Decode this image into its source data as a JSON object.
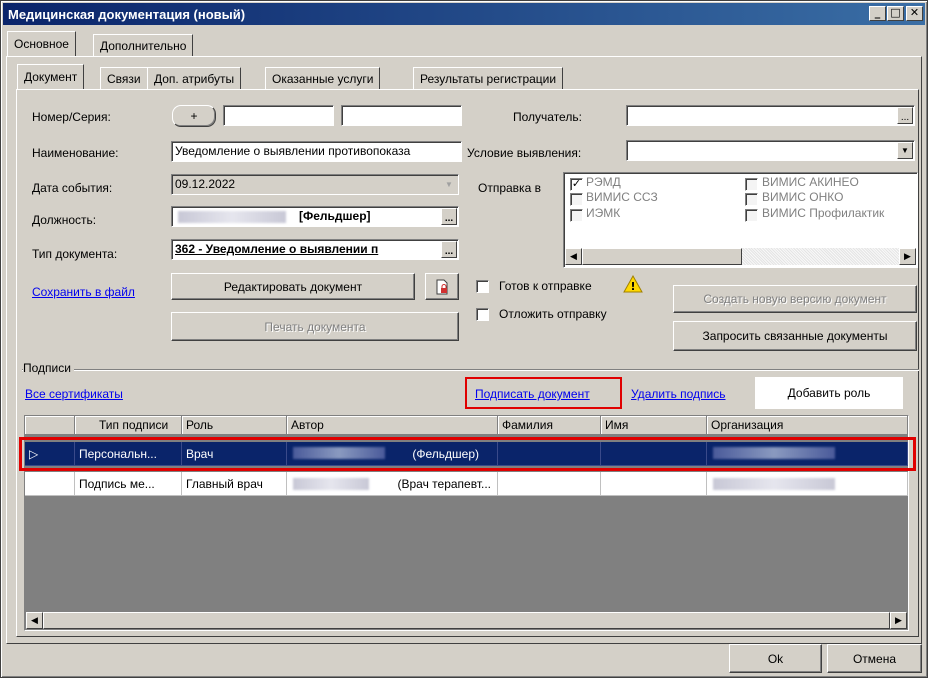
{
  "window": {
    "title": "Медицинская документация (новый)",
    "minimize": "_",
    "maximize": "□",
    "close": "✕"
  },
  "outer_tabs": [
    "Основное",
    "Дополнительно"
  ],
  "inner_tabs": [
    "Документ",
    "Связи",
    "Доп. атрибуты",
    "Оказанные услуги",
    "Результаты регистрации"
  ],
  "form": {
    "number_label": "Номер/Серия:",
    "plus": "+",
    "name_label": "Наименование:",
    "name_value": "Уведомление о выявлении противопоказа",
    "date_label": "Дата события:",
    "date_value": "09.12.2022",
    "position_label": "Должность:",
    "position_value": "[Фельдшер]",
    "doctype_label": "Тип документа:",
    "doctype_value": "362 - Уведомление о выявлении п",
    "save_file": "Сохранить в файл",
    "edit_doc": "Редактировать документ",
    "print_doc": "Печать документа",
    "recipient_label": "Получатель:",
    "condition_label": "Условие выявления:",
    "send_label": "Отправка в",
    "send_options": [
      {
        "label": "РЭМД",
        "checked": "✓"
      },
      {
        "label": "ВИМИС АКИНЕО",
        "checked": ""
      },
      {
        "label": "ВИМИС ССЗ",
        "checked": ""
      },
      {
        "label": "ВИМИС ОНКО",
        "checked": ""
      },
      {
        "label": "ИЭМК",
        "checked": ""
      },
      {
        "label": "ВИМИС Профилактик",
        "checked": ""
      }
    ],
    "ready_label": "Готов к отправке",
    "warning_icon": "!",
    "postpone_label": "Отложить отправку",
    "new_version": "Создать новую версию документ",
    "request_related": "Запросить связанные документы"
  },
  "signatures": {
    "group_label": "Подписи",
    "all_certs": "Все сертификаты",
    "sign_doc": "Подписать документ",
    "delete_sign": "Удалить подпись",
    "add_role": "Добавить роль",
    "columns": [
      "Тип подписи",
      "Роль",
      "Автор",
      "Фамилия",
      "Имя",
      "Организация"
    ],
    "rows": [
      {
        "indicator": "▷",
        "type": "Персональн...",
        "role": "Врач",
        "author": "(Фельдшер)",
        "lastname": "",
        "firstname": "",
        "org": ""
      },
      {
        "indicator": "",
        "type": "Подпись ме...",
        "role": "Главный врач",
        "author": "(Врач терапевт...",
        "lastname": "",
        "firstname": "",
        "org": ""
      }
    ]
  },
  "footer": {
    "ok": "Ok",
    "cancel": "Отмена"
  }
}
